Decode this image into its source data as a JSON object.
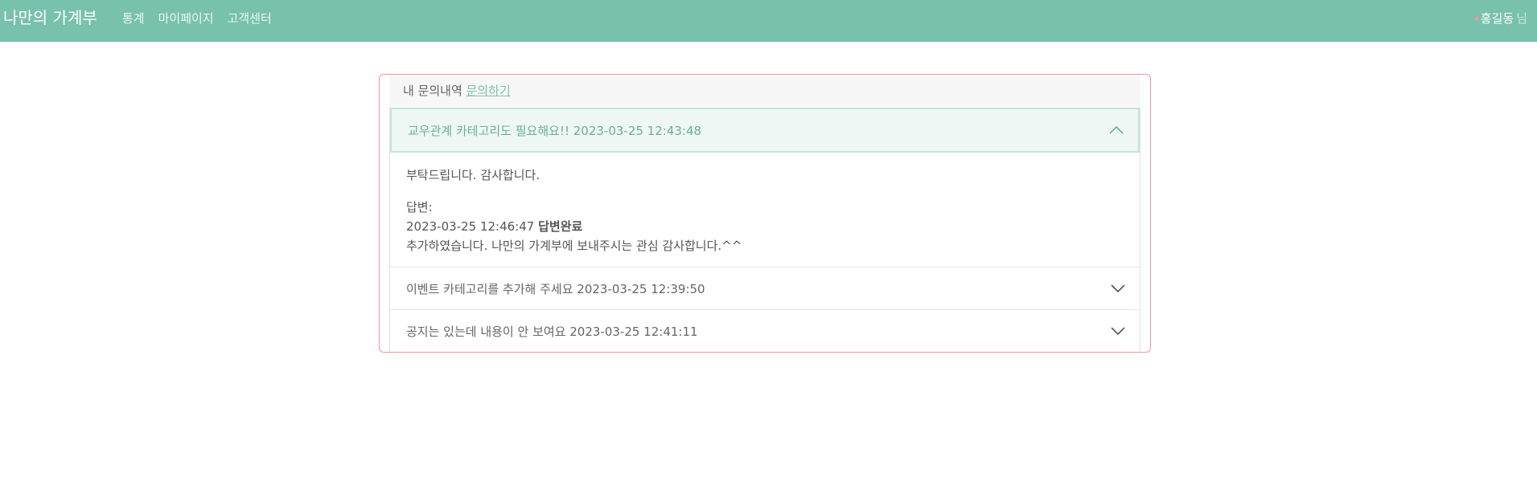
{
  "navbar": {
    "brand": "나만의 가계부",
    "links": [
      "통계",
      "마이페이지",
      "고객센터"
    ],
    "user_name": "홍길동",
    "user_suffix": "님"
  },
  "card": {
    "header_label": "내 문의내역",
    "write_link": "문의하기"
  },
  "inquiries": [
    {
      "title": "교우관계 카테고리도 필요해요!! 2023-03-25 12:43:48",
      "expanded": true,
      "content": "부탁드립니다. 감사합니다.",
      "answer_label": "답변:",
      "answer_time": "2023-03-25 12:46:47",
      "answer_status": "답변완료",
      "answer_text": "추가하였습니다. 나만의 가계부에 보내주시는 관심 감사합니다.^^"
    },
    {
      "title": "이벤트 카테고리를 추가해 주세요 2023-03-25 12:39:50",
      "expanded": false
    },
    {
      "title": "공지는 있는데 내용이 안 보여요 2023-03-25 12:41:11",
      "expanded": false
    }
  ],
  "colors": {
    "primary": "#78c2ad",
    "secondary": "#f3969a"
  },
  "icons": {
    "expanded": "chevron-up-icon",
    "collapsed": "chevron-down-icon",
    "user_menu": "caret-left-icon"
  }
}
